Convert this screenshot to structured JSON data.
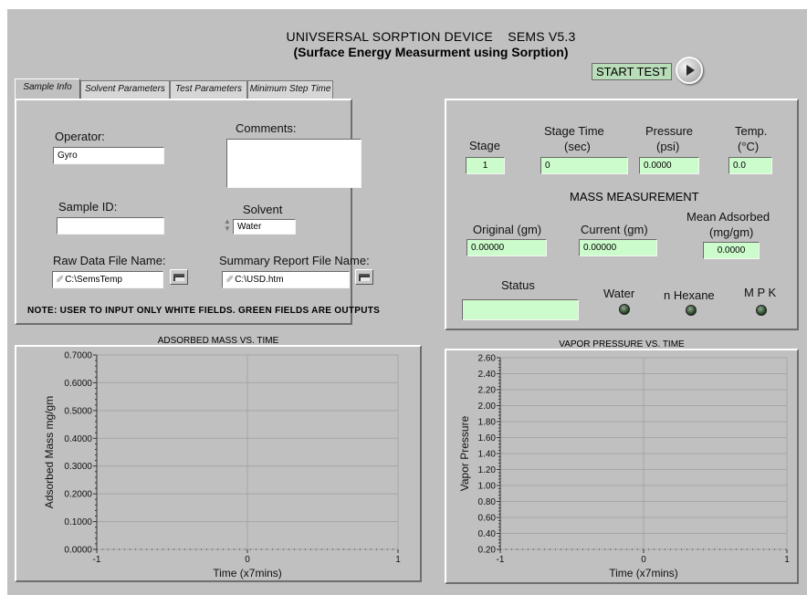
{
  "header": {
    "title_line1": "UNIVSERSAL SORPTION DEVICE    SEMS V5.3",
    "title_line2": "(Surface Energy Measurment using Sorption)"
  },
  "start": {
    "label": "START TEST"
  },
  "tabs": [
    {
      "label": "Sample Info",
      "active": true
    },
    {
      "label": "Solvent Parameters"
    },
    {
      "label": "Test Parameters"
    },
    {
      "label": "Minimum Step Time"
    }
  ],
  "sample": {
    "operator_label": "Operator:",
    "operator_value": "Gyro",
    "comments_label": "Comments:",
    "comments_value": "",
    "sample_id_label": "Sample ID:",
    "sample_id_value": "",
    "solvent_label": "Solvent",
    "solvent_value": "Water",
    "raw_file_label": "Raw Data File Name:",
    "raw_file_value": "C:\\SemsTemp",
    "summary_file_label": "Summary Report File Name:",
    "summary_file_value": "C:\\USD.htm",
    "note": "NOTE: USER TO INPUT ONLY WHITE FIELDS. GREEN FIELDS ARE OUTPUTS"
  },
  "status_panel": {
    "stage_label": "Stage",
    "stage_value": "1",
    "stage_time_label_1": "Stage Time",
    "stage_time_label_2": "(sec)",
    "stage_time_value": "0",
    "pressure_label_1": "Pressure",
    "pressure_label_2": "(psi)",
    "pressure_value": "0.0000",
    "temp_label_1": "Temp.",
    "temp_label_2": "(°C)",
    "temp_value": "0.0",
    "mass_title": "MASS MEASUREMENT",
    "original_label": "Original (gm)",
    "original_value": "0.00000",
    "current_label": "Current (gm)",
    "current_value": "0.00000",
    "mean_label_1": "Mean Adsorbed",
    "mean_label_2": "(mg/gm)",
    "mean_value": "0.0000",
    "status_label": "Status",
    "status_value": "",
    "led_water": "Water",
    "led_hexane": "n Hexane",
    "led_mpk": "M P K"
  },
  "chart_data": [
    {
      "type": "line",
      "title": "ADSORBED MASS VS. TIME",
      "xlabel": "Time (x7mins)",
      "ylabel": "Adsorbed Mass mg/gm",
      "xlim": [
        -1,
        1
      ],
      "ylim": [
        0,
        0.7
      ],
      "x_ticks": [
        "-1",
        "0",
        "1"
      ],
      "y_ticks": [
        "0.0000",
        "0.1000",
        "0.2000",
        "0.3000",
        "0.4000",
        "0.5000",
        "0.6000",
        "0.7000"
      ],
      "grid": true,
      "series": []
    },
    {
      "type": "line",
      "title": "VAPOR PRESSURE VS. TIME",
      "xlabel": "Time (x7mins)",
      "ylabel": "Vapor Pressure",
      "xlim": [
        -1,
        1
      ],
      "ylim": [
        0.2,
        2.6
      ],
      "x_ticks": [
        "-1",
        "0",
        "1"
      ],
      "y_ticks": [
        "0.20",
        "0.40",
        "0.60",
        "0.80",
        "1.00",
        "1.20",
        "1.40",
        "1.60",
        "1.80",
        "2.00",
        "2.20",
        "2.40",
        "2.60"
      ],
      "grid": true,
      "series": []
    }
  ]
}
